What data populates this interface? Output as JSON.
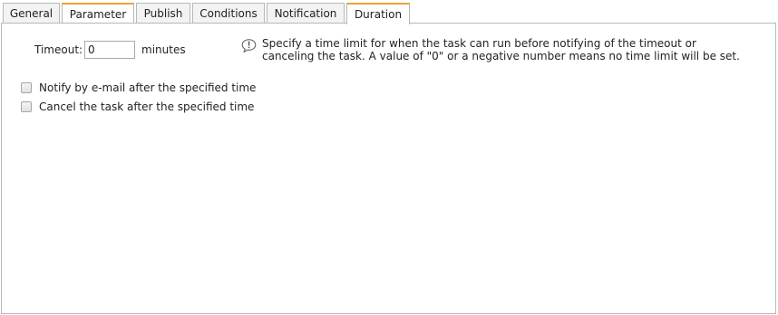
{
  "tabs": [
    {
      "label": "General"
    },
    {
      "label": "Parameter"
    },
    {
      "label": "Publish"
    },
    {
      "label": "Conditions"
    },
    {
      "label": "Notification"
    },
    {
      "label": "Duration"
    }
  ],
  "active_tab": "Duration",
  "accent_color": "#f0a030",
  "timeout": {
    "label": "Timeout:",
    "value": "0",
    "unit": "minutes"
  },
  "info": {
    "icon": "info-bubble-icon",
    "text": "Specify a time limit for when the task can run before notifying of the timeout or canceling the task. A value of \"0\" or a negative number means no time limit will be set."
  },
  "options": [
    {
      "label": "Notify by e-mail after the specified time",
      "checked": false
    },
    {
      "label": "Cancel the task after the specified time",
      "checked": false
    }
  ]
}
